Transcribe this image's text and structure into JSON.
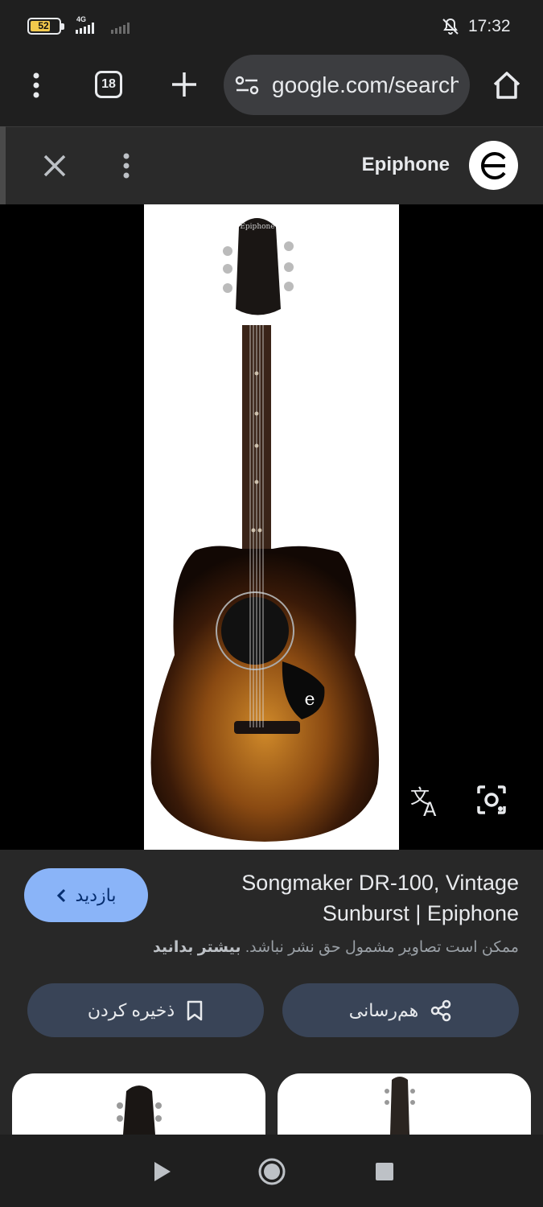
{
  "status_bar": {
    "battery": "52",
    "network": "4G",
    "time": "17:32"
  },
  "browser": {
    "tab_count": "18",
    "url": "google.com/search"
  },
  "viewer": {
    "source_name": "Epiphone"
  },
  "result": {
    "visit_label": "بازدید",
    "title": "Songmaker DR-100, Vintage Sunburst | Epiphone",
    "copyright_notice": "ممکن است تصاویر مشمول حق نشر نباشد.",
    "learn_more": "بیشتر بدانید",
    "share_label": "هم‌رسانی",
    "save_label": "ذخیره کردن"
  },
  "colors": {
    "accent": "#8ab4f8",
    "pill_bg": "#394457",
    "background": "#1f1f1f"
  }
}
